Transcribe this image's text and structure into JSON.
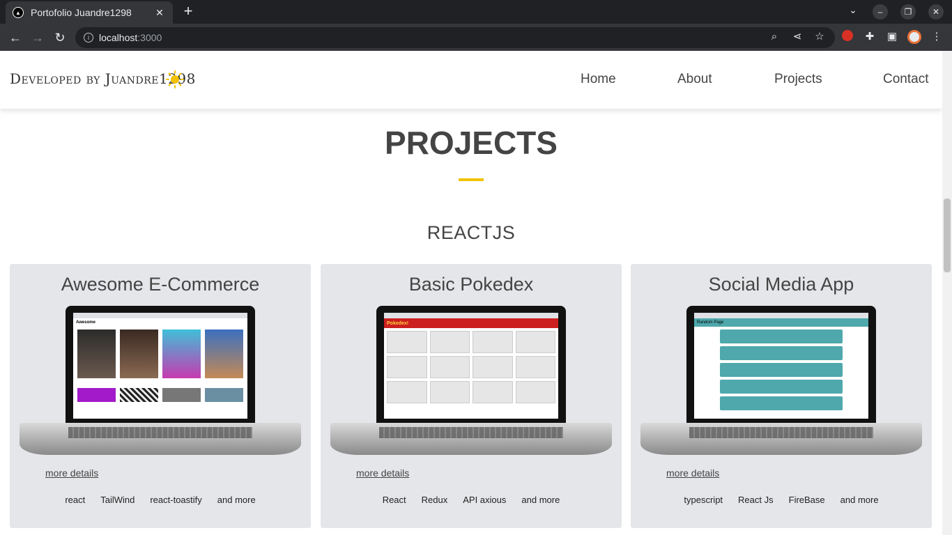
{
  "browser": {
    "tab_title": "Portofolio Juandre1298",
    "tab_close": "✕",
    "new_tab": "+",
    "url_host": "localhost",
    "url_port": ":3000"
  },
  "header": {
    "brand": "Developed by Juandre1298",
    "nav": {
      "home": "Home",
      "about": "About",
      "projects": "Projects",
      "contact": "Contact"
    }
  },
  "section": {
    "title": "PROJECTS",
    "subtitle": "REACTJS"
  },
  "projects": [
    {
      "title": "Awesome E-Commerce",
      "more": "more details",
      "tags": [
        "react",
        "TailWind",
        "react-toastify",
        "and more"
      ],
      "screen_label": "Awesome"
    },
    {
      "title": "Basic Pokedex",
      "more": "more details",
      "tags": [
        "React",
        "Redux",
        "API axious",
        "and more"
      ],
      "screen_label": "Pokedex!"
    },
    {
      "title": "Social Media App",
      "more": "more details",
      "tags": [
        "typescript",
        "React Js",
        "FireBase",
        "and more"
      ],
      "screen_label": "Random Page"
    }
  ],
  "colors": {
    "accent": "#f2c200",
    "card_bg": "#e4e6e9",
    "pokedex_red": "#cc1f1f",
    "social_teal": "#4fa8ac"
  }
}
